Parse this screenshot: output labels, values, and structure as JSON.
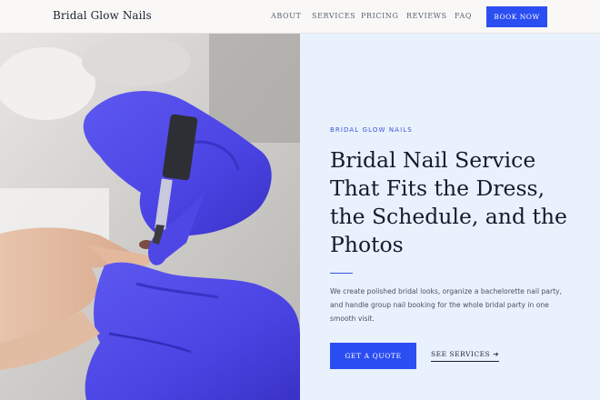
{
  "header": {
    "brand": "Bridal Glow Nails",
    "nav": [
      {
        "label": "ABOUT",
        "name": "nav-about"
      },
      {
        "label": "SERVICES",
        "name": "nav-services"
      },
      {
        "label": "PRICING",
        "name": "nav-pricing"
      },
      {
        "label": "REVIEWS",
        "name": "nav-reviews"
      },
      {
        "label": "FAQ",
        "name": "nav-faq"
      }
    ],
    "cta_label": "BOOK NOW"
  },
  "hero": {
    "eyebrow": "BRIDAL GLOW NAILS",
    "headline_lines": [
      "Bridal Nail Service",
      "That Fits the Dress,",
      "the Schedule, and the",
      "Photos"
    ],
    "description": "We create polished bridal looks, organize a bachelorette nail party, and handle group nail booking for the whole bridal party in one smooth visit.",
    "primary_cta": "GET A QUOTE",
    "secondary_cta": "SEE SERVICES",
    "secondary_arrow": "➔"
  },
  "colors": {
    "accent": "#2b4ef2",
    "panel_bg": "#e9f1fd",
    "header_bg": "#f9f8f6",
    "glove": "#4b45e6"
  }
}
